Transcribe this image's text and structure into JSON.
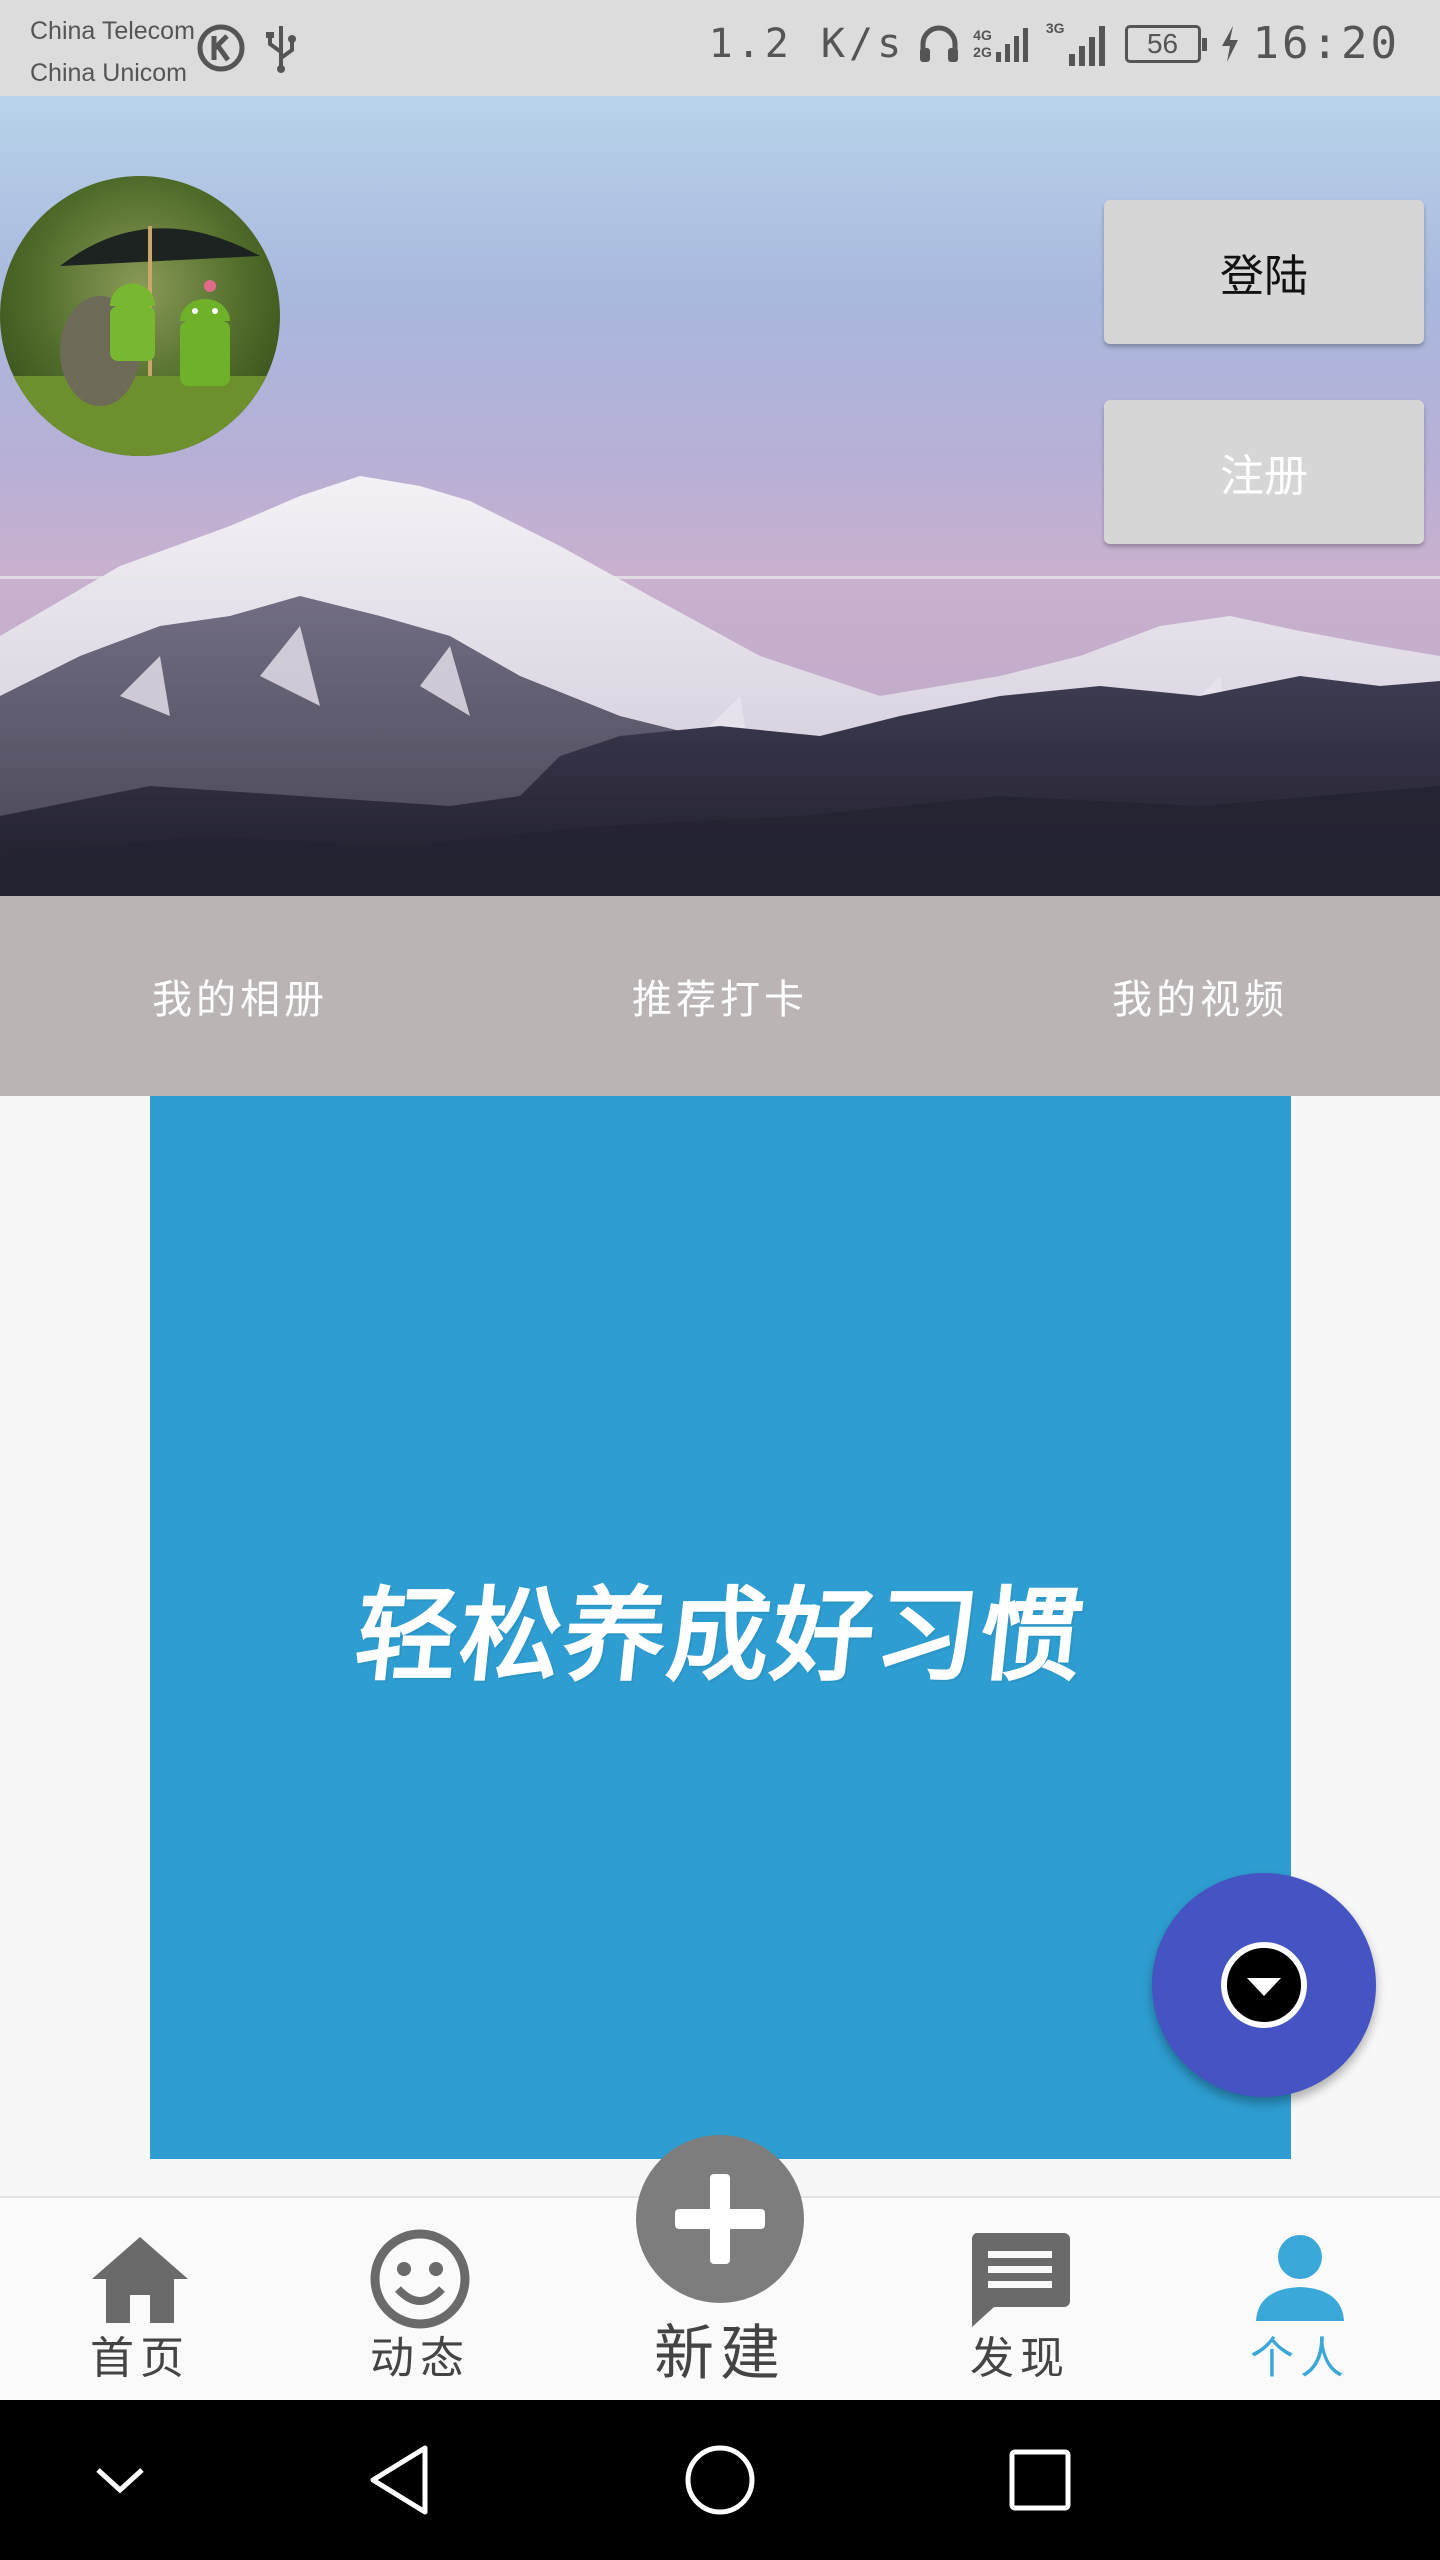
{
  "status_bar": {
    "carrier_1": "China Telecom",
    "carrier_2": "China Unicom",
    "net_speed": "1.2 K/s",
    "signal_1_top": "4G",
    "signal_1_bottom": "2G",
    "signal_2": "3G",
    "battery": "56",
    "time": "16:20"
  },
  "header": {
    "login_button": "登陆",
    "register_button": "注册"
  },
  "tabs": [
    {
      "label": "我的相册"
    },
    {
      "label": "推荐打卡"
    },
    {
      "label": "我的视频"
    }
  ],
  "hero": {
    "headline": "轻松养成好习惯",
    "background_color": "#2e9dd1"
  },
  "fab": {
    "icon": "dropdown-circle-icon",
    "color": "#4553c3"
  },
  "bottom_nav": {
    "items": [
      {
        "label": "首页",
        "icon": "home-icon"
      },
      {
        "label": "动态",
        "icon": "smiley-icon"
      },
      {
        "label": "新建",
        "icon": "plus-icon"
      },
      {
        "label": "发现",
        "icon": "message-icon"
      },
      {
        "label": "个人",
        "icon": "person-icon",
        "active": true
      }
    ],
    "active_color": "#3aa8d8"
  },
  "system_nav": {
    "buttons": [
      "collapse-icon",
      "back-icon",
      "home-circle-icon",
      "recents-icon"
    ]
  }
}
